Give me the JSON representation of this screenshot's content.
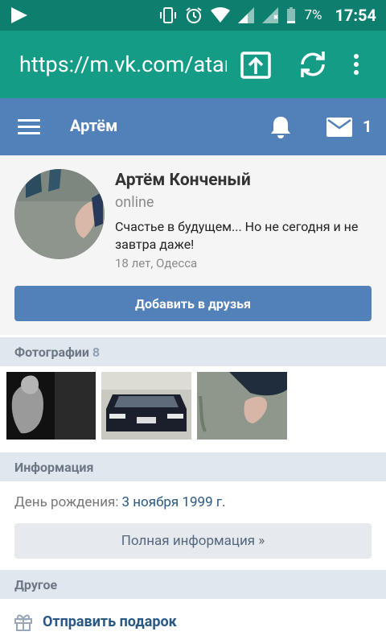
{
  "status_bar": {
    "battery": "7%",
    "time": "17:54"
  },
  "browser": {
    "url": "https://m.vk.com/atarax"
  },
  "header": {
    "title": "Артём",
    "messages_count": "1"
  },
  "profile": {
    "name": "Артём Конченый",
    "presence": "online",
    "status": "Счастье в будущем... Но не сегодня и не завтра даже!",
    "location": "18 лет, Одесса",
    "add_friend_label": "Добавить в друзья"
  },
  "photos": {
    "heading": "Фотографии",
    "count": "8"
  },
  "info": {
    "heading": "Информация",
    "birthday_label": "День рождения:",
    "birthday_value": "3 ноября 1999 г.",
    "full_info_label": "Полная информация »"
  },
  "other": {
    "heading": "Другое",
    "send_gift_label": "Отправить подарок"
  },
  "colors": {
    "status_bar": "#0e7f6f",
    "browser_bar": "#159c87",
    "vk_blue": "#5181b8",
    "link": "#2a5885"
  }
}
